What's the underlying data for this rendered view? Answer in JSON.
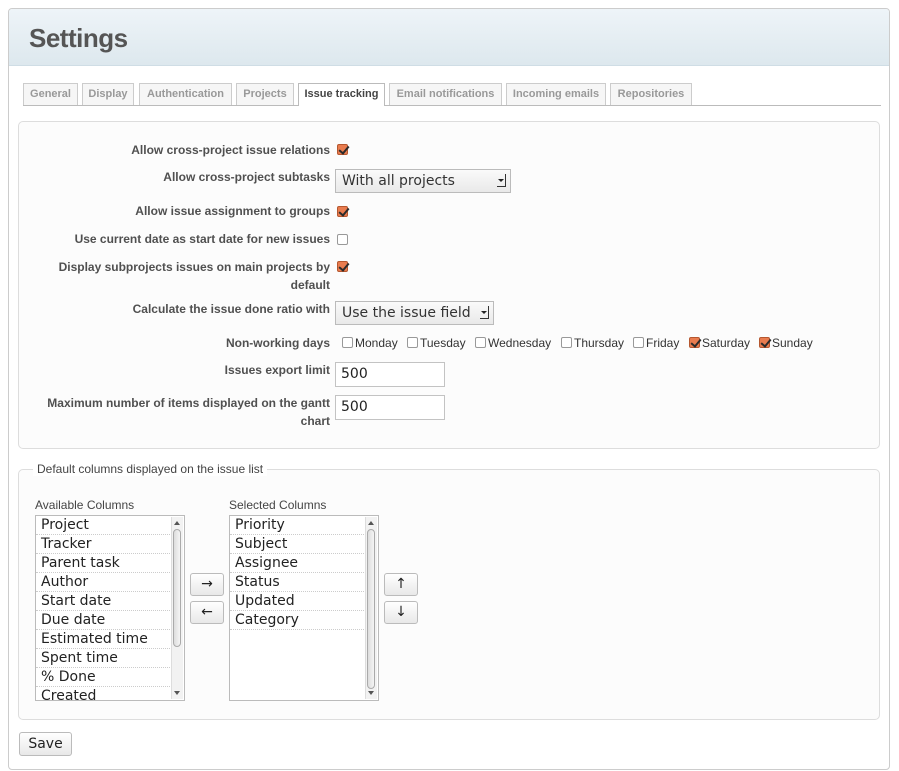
{
  "page": {
    "title": "Settings"
  },
  "tabs": [
    {
      "label": "General"
    },
    {
      "label": "Display"
    },
    {
      "label": "Authentication"
    },
    {
      "label": "Projects"
    },
    {
      "label": "Issue tracking"
    },
    {
      "label": "Email notifications"
    },
    {
      "label": "Incoming emails"
    },
    {
      "label": "Repositories"
    }
  ],
  "active_tab": "Issue tracking",
  "settings": {
    "cross_project_relations": {
      "label": "Allow cross-project issue relations",
      "checked": true
    },
    "cross_project_subtasks": {
      "label": "Allow cross-project subtasks",
      "value": "With all projects"
    },
    "assignment_to_groups": {
      "label": "Allow issue assignment to groups",
      "checked": true
    },
    "current_date_start": {
      "label": "Use current date as start date for new issues",
      "checked": false
    },
    "display_subprojects": {
      "label_line1": "Display subprojects issues on main projects by",
      "label_line2": "default",
      "checked": true
    },
    "done_ratio": {
      "label": "Calculate the issue done ratio with",
      "value": "Use the issue field"
    },
    "non_working_days": {
      "label": "Non-working days",
      "days": [
        {
          "label": "Monday",
          "checked": false
        },
        {
          "label": "Tuesday",
          "checked": false
        },
        {
          "label": "Wednesday",
          "checked": false
        },
        {
          "label": "Thursday",
          "checked": false
        },
        {
          "label": "Friday",
          "checked": false
        },
        {
          "label": "Saturday",
          "checked": true
        },
        {
          "label": "Sunday",
          "checked": true
        }
      ]
    },
    "export_limit": {
      "label": "Issues export limit",
      "value": "500"
    },
    "gantt_limit": {
      "label_line1": "Maximum number of items displayed on the gantt",
      "label_line2": "chart",
      "value": "500"
    }
  },
  "columns": {
    "legend": "Default columns displayed on the issue list",
    "available_label": "Available Columns",
    "selected_label": "Selected Columns",
    "available": [
      "Project",
      "Tracker",
      "Parent task",
      "Author",
      "Start date",
      "Due date",
      "Estimated time",
      "Spent time",
      "% Done",
      "Created"
    ],
    "selected": [
      "Priority",
      "Subject",
      "Assignee",
      "Status",
      "Updated",
      "Category"
    ],
    "add_arrow": "→",
    "remove_arrow": "←",
    "up_arrow": "↑",
    "down_arrow": "↓"
  },
  "save_label": "Save",
  "colors": {
    "accent_check": "#e97c4f",
    "header_bg": "#dde8ee"
  }
}
